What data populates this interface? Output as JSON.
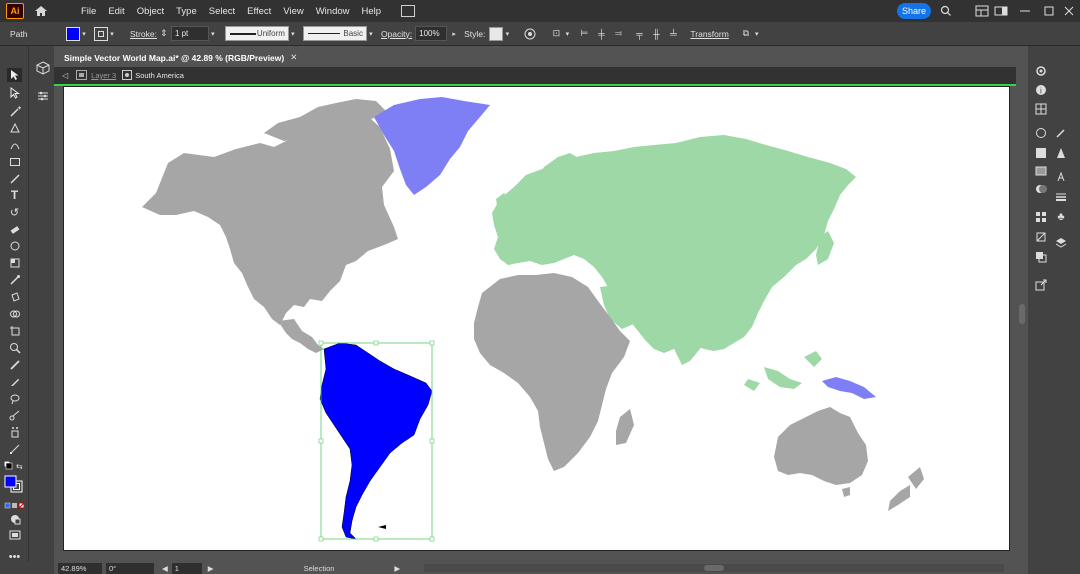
{
  "app": {
    "logo": "Ai",
    "menu": [
      "File",
      "Edit",
      "Object",
      "Type",
      "Select",
      "Effect",
      "View",
      "Window",
      "Help"
    ],
    "share_label": "Share"
  },
  "control_bar": {
    "selection_type": "Path",
    "fill_color": "#0000ff",
    "stroke_label": "Stroke:",
    "stroke_weight": "1 pt",
    "stroke_profile": "Uniform",
    "brush": "Basic",
    "opacity_label": "Opacity:",
    "opacity_value": "100%",
    "style_label": "Style:",
    "transform_label": "Transform"
  },
  "document": {
    "tab_title": "Simple Vector World Map.ai* @ 42.89 % (RGB/Preview)",
    "breadcrumb": [
      "Layer 3",
      "South America"
    ]
  },
  "status": {
    "zoom": "42.89%",
    "rotation": "0°",
    "artboard_number": "1",
    "tool_name": "Selection"
  },
  "map": {
    "colors": {
      "north_america": "#a6a6a6",
      "greenland": "#7f7ff5",
      "south_america": "#0000ff",
      "eurasia": "#9dd8a6",
      "africa": "#a6a6a6",
      "australia": "#a6a6a6",
      "new_guinea": "#7f7ff5",
      "selection_box": "#55cc66"
    }
  },
  "icons": {
    "home": "home-icon",
    "arrange": "arrange-documents-icon",
    "minimize": "minimize-icon",
    "maximize": "maximize-icon",
    "close": "close-icon"
  }
}
